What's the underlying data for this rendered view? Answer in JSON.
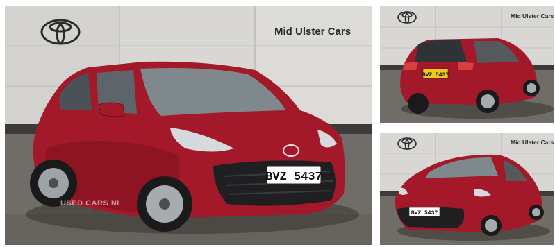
{
  "gallery": {
    "main": {
      "dealer_name": "Mid Ulster Cars",
      "logo": "toyota-logo-icon",
      "plate": "BVZ 5437",
      "watermark": "USED CARS NI"
    },
    "thumbnails": [
      {
        "dealer_name": "Mid Ulster Cars",
        "logo": "toyota-logo-icon",
        "plate": "BVZ 5437",
        "view": "rear"
      },
      {
        "dealer_name": "Mid Ulster Cars",
        "logo": "toyota-logo-icon",
        "plate": "BVZ 5437",
        "view": "front"
      }
    ]
  },
  "colors": {
    "car_body": "#a3192a",
    "wall": "#d9d8d4",
    "ground": "#6f6b66",
    "plate_yellow": "#f2c81e"
  }
}
